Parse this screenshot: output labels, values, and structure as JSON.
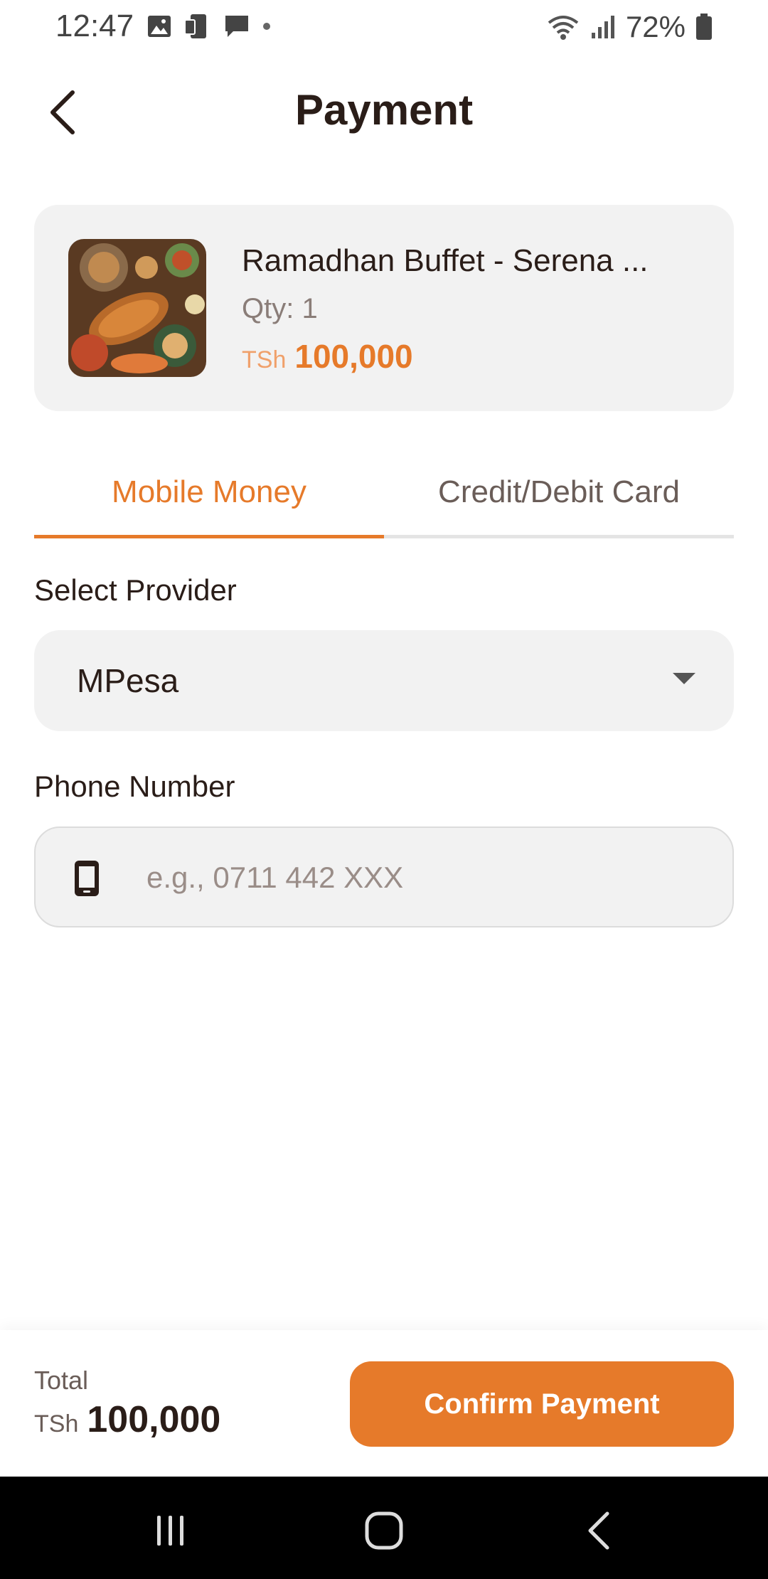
{
  "status_bar": {
    "time": "12:47",
    "battery": "72%",
    "icons_left": [
      "image-icon",
      "device-icon",
      "message-icon",
      "dot-icon"
    ],
    "icons_right": [
      "wifi-icon",
      "signal-icon",
      "battery-icon"
    ]
  },
  "header": {
    "title": "Payment",
    "back_icon": "chevron-left-icon"
  },
  "product": {
    "title": "Ramadhan Buffet - Serena ...",
    "qty": "Qty: 1",
    "currency": "TSh",
    "price": "100,000"
  },
  "tabs": [
    {
      "label": "Mobile Money",
      "active": true
    },
    {
      "label": "Credit/Debit Card",
      "active": false
    }
  ],
  "form": {
    "provider_label": "Select Provider",
    "provider_value": "MPesa",
    "phone_label": "Phone Number",
    "phone_placeholder": "e.g., 0711 442 XXX",
    "phone_value": ""
  },
  "footer": {
    "total_label": "Total",
    "currency": "TSh",
    "total_value": "100,000",
    "confirm_label": "Confirm Payment"
  },
  "colors": {
    "accent": "#e67a2a",
    "text_dark": "#2a1d18",
    "card_bg": "#f2f2f2"
  }
}
